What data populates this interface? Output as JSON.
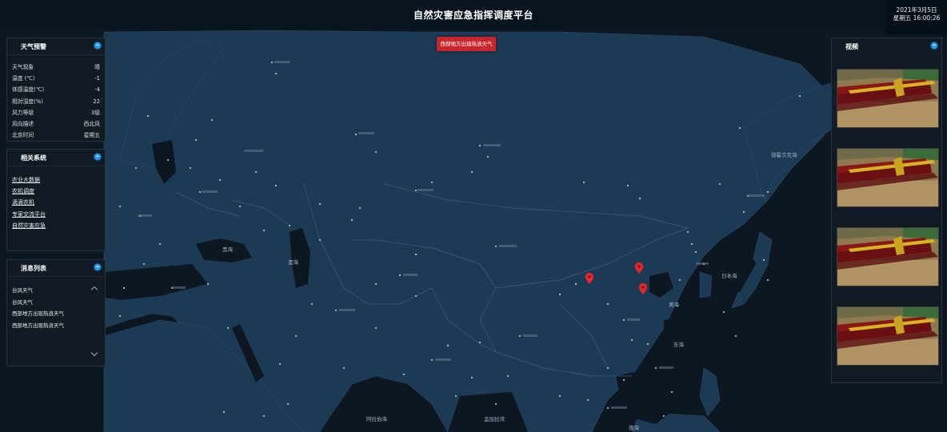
{
  "header": {
    "title": "自然灾害应急指挥调度平台",
    "date": "2021年3月5日",
    "weekday_time": "星期五 16:00:26"
  },
  "alert": {
    "text": "西部地方出现热浪天气"
  },
  "weather": {
    "title": "天气预警",
    "rows": [
      {
        "key": "天气现象",
        "value": "晴"
      },
      {
        "key": "温度 (℃)",
        "value": "-1"
      },
      {
        "key": "体感温度(℃)",
        "value": "-4"
      },
      {
        "key": "相对湿度(%)",
        "value": "22"
      },
      {
        "key": "风力等级",
        "value": "3级"
      },
      {
        "key": "风向描述",
        "value": "西北风"
      },
      {
        "key": "北京时间",
        "value": "星期五"
      }
    ]
  },
  "systems": {
    "title": "相关系统",
    "links": [
      "农业大数据",
      "农机调度",
      "滴滴农机",
      "专家交流平台",
      "自然灾害应急"
    ]
  },
  "messages": {
    "title": "消息列表",
    "items": [
      "台风天气",
      "台风天气",
      "西部地方出现热浪天气",
      "西部地方出现热浪天气"
    ]
  },
  "video": {
    "title": "视频"
  },
  "map": {
    "seas": [
      "黑海",
      "里海",
      "日本海",
      "黄海",
      "东海",
      "南海",
      "阿拉伯海",
      "孟加拉湾",
      "鄂霍次克海"
    ],
    "colors": {
      "land": "#1d3a55",
      "water": "#0c1722",
      "border": "#3a5c7a",
      "label": "#8fa2b6"
    }
  },
  "colors": {
    "alert": "#c8262c",
    "accent": "#1f9bff",
    "panel": "#121b24",
    "marker": "#e8262c"
  }
}
